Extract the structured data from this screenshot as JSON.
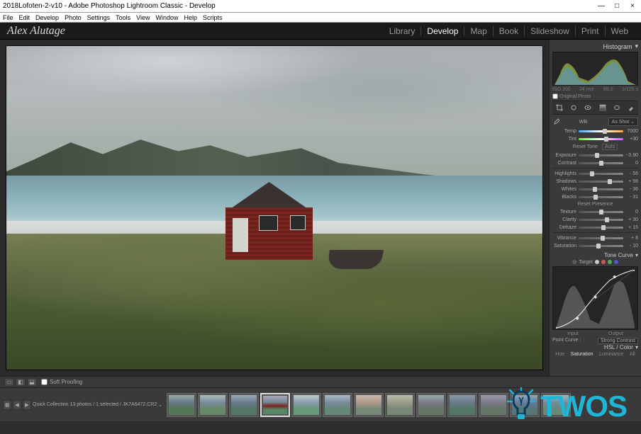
{
  "window": {
    "title": "2018Lofoten-2-v10 - Adobe Photoshop Lightroom Classic - Develop",
    "controls": {
      "min": "—",
      "max": "□",
      "close": "×"
    }
  },
  "menubar": [
    "File",
    "Edit",
    "Develop",
    "Photo",
    "Settings",
    "Tools",
    "View",
    "Window",
    "Help",
    "Scripts"
  ],
  "topbar": {
    "logo": "Alex Alutage",
    "modules": [
      "Library",
      "Develop",
      "Map",
      "Book",
      "Slideshow",
      "Print",
      "Web"
    ],
    "active_module": "Develop"
  },
  "panels": {
    "histogram": {
      "title": "Histogram",
      "iso": "ISO 200",
      "focal": "24 mm",
      "aperture": "f/8.0",
      "shutter": "1/125 s"
    },
    "original_photo_label": "Original Photo",
    "original_checked": false,
    "basic": {
      "wb_label": "WB:",
      "wb_value": "As Shot",
      "temp": {
        "label": "Temp",
        "value": "7000",
        "pos": "58%"
      },
      "tint": {
        "label": "Tint",
        "value": "+30",
        "pos": "62%"
      },
      "tone_label": "Reset Tone",
      "auto_label": "Auto",
      "exposure": {
        "label": "Exposure",
        "value": "- 0.90",
        "pos": "42%"
      },
      "contrast": {
        "label": "Contrast",
        "value": "0",
        "pos": "50%"
      },
      "highlights": {
        "label": "Highlights",
        "value": "- 56",
        "pos": "30%"
      },
      "shadows": {
        "label": "Shadows",
        "value": "+ 56",
        "pos": "70%"
      },
      "whites": {
        "label": "Whites",
        "value": "- 36",
        "pos": "36%"
      },
      "blacks": {
        "label": "Blacks",
        "value": "- 31",
        "pos": "38%"
      },
      "presence_label": "Reset Presence",
      "texture": {
        "label": "Texture",
        "value": "0",
        "pos": "50%"
      },
      "clarity": {
        "label": "Clarity",
        "value": "+ 30",
        "pos": "64%"
      },
      "dehaze": {
        "label": "Dehaze",
        "value": "+ 15",
        "pos": "56%"
      },
      "vibrance": {
        "label": "Vibrance",
        "value": "+ 8",
        "pos": "54%"
      },
      "saturation": {
        "label": "Saturation",
        "value": "- 10",
        "pos": "45%"
      }
    },
    "tonecurve": {
      "title": "Tone Curve",
      "region_label": "Input",
      "output_label": "Output",
      "preset_label": "Point Curve :",
      "preset_value": "Strong Contrast",
      "targets": {
        "rgb": "#ccc",
        "r": "#c55",
        "g": "#5a5",
        "b": "#55c"
      }
    },
    "hsl": {
      "title": "HSL / Color",
      "tabs": [
        "Hue",
        "Saturation",
        "Luminance",
        "All"
      ],
      "active": "Saturation"
    }
  },
  "toolbar": {
    "soft_proof_label": "Soft Proofing",
    "soft_proof_checked": false
  },
  "filmstrip": {
    "collection_label": "Quick Collection",
    "count_label": "13 photos / 1 selected /",
    "filename": "JK7A6472.CR2",
    "selected_index": 3,
    "thumb_count": 13
  },
  "overlay": {
    "brand": "TWOS"
  },
  "colors": {
    "accent": "#1fb5d6"
  }
}
